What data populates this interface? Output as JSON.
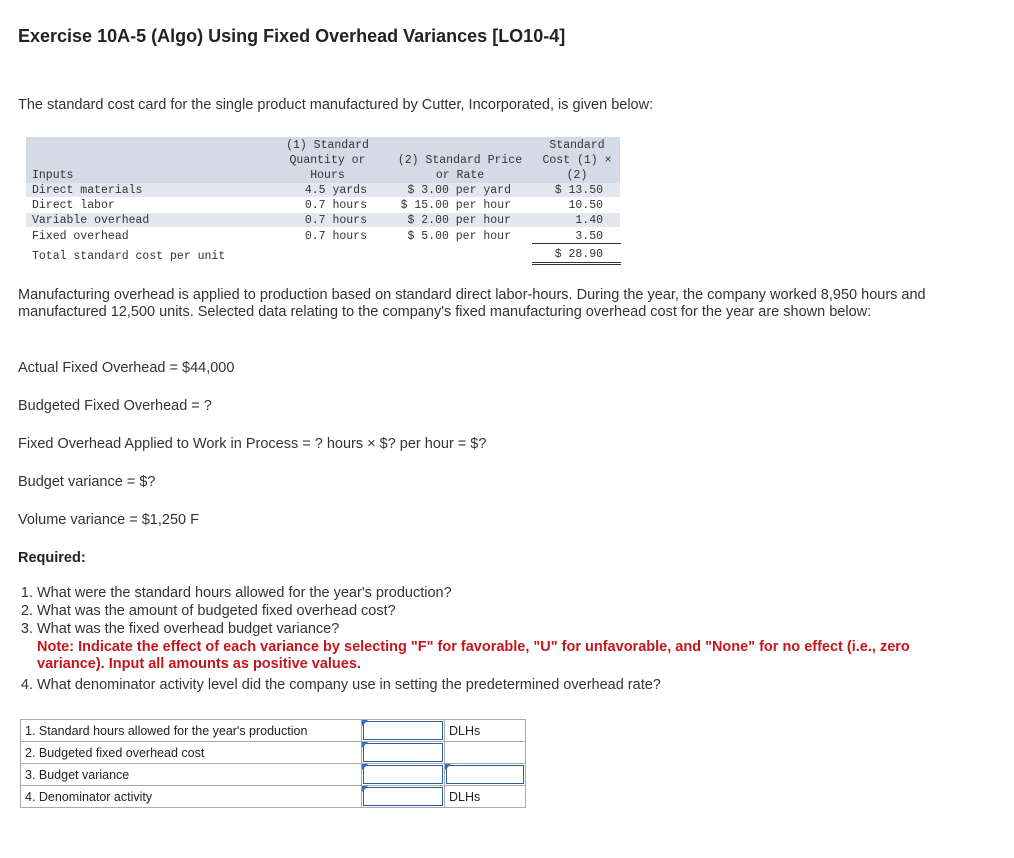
{
  "title": "Exercise 10A-5 (Algo) Using Fixed Overhead Variances [LO10-4]",
  "intro": "The standard cost card for the single product manufactured by Cutter, Incorporated, is given below:",
  "cost_card": {
    "col1_header": [
      "(1) Standard",
      "Quantity or",
      "Hours"
    ],
    "col2_header": [
      "(2) Standard Price",
      "or Rate"
    ],
    "col3_header": [
      "Standard",
      "Cost (1) ×",
      "(2)"
    ],
    "inputs_header": "Inputs",
    "rows": [
      {
        "label": "Direct materials",
        "qty": "4.5 yards",
        "price": "$ 3.00 per yard",
        "cost": "$ 13.50"
      },
      {
        "label": "Direct labor",
        "qty": "0.7 hours",
        "price": "$ 15.00 per hour",
        "cost": "10.50"
      },
      {
        "label": "Variable overhead",
        "qty": "0.7 hours",
        "price": "$ 2.00 per hour",
        "cost": "1.40"
      },
      {
        "label": "Fixed overhead",
        "qty": "0.7 hours",
        "price": "$ 5.00 per hour",
        "cost": "3.50"
      }
    ],
    "total_label": "Total standard cost per unit",
    "total_value": "$ 28.90"
  },
  "paragraph2": "Manufacturing overhead is applied to production based on standard direct labor-hours. During the year, the company worked 8,950 hours and manufactured 12,500 units. Selected data relating to the company's fixed manufacturing overhead cost for the year are shown below:",
  "data_lines": [
    "Actual Fixed Overhead = $44,000",
    "Budgeted Fixed Overhead = ?",
    "Fixed Overhead Applied to Work in Process = ? hours × $? per hour = $?",
    "Budget variance = $?",
    "Volume variance = $1,250 F"
  ],
  "required_label": "Required:",
  "questions": [
    "What were the standard hours allowed for the year's production?",
    "What was the amount of budgeted fixed overhead cost?",
    "What was the fixed overhead budget variance?",
    "What denominator activity level did the company use in setting the predetermined overhead rate?"
  ],
  "note": "Note: Indicate the effect of each variance by selecting \"F\" for favorable, \"U\" for unfavorable, and \"None\" for no effect (i.e., zero variance). Input all amounts as positive values.",
  "answers": [
    {
      "label": "1. Standard hours allowed for the year's production",
      "value": "",
      "unit": "DLHs"
    },
    {
      "label": "2. Budgeted fixed overhead cost",
      "value": "",
      "unit": ""
    },
    {
      "label": "3. Budget variance",
      "value": "",
      "unit": ""
    },
    {
      "label": "4. Denominator activity",
      "value": "",
      "unit": "DLHs"
    }
  ],
  "colors": {
    "note_red": "#c4161c",
    "header_band": "#d4dbe7",
    "input_border": "#2b5f9b"
  }
}
